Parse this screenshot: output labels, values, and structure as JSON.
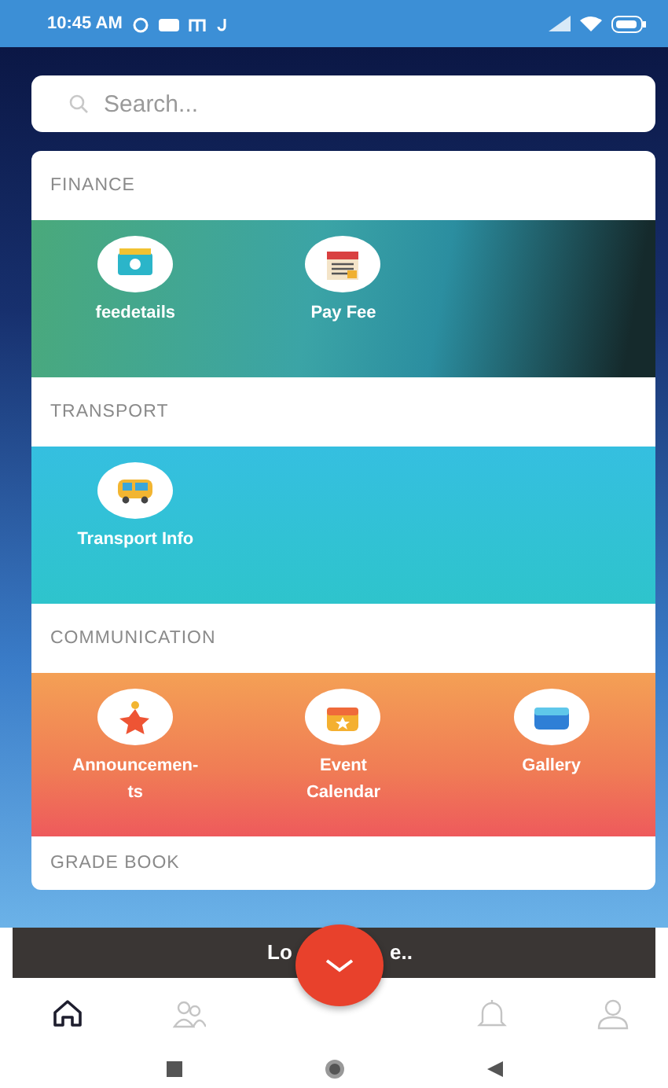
{
  "status_bar": {
    "time": "10:45 AM"
  },
  "search": {
    "placeholder": "Search..."
  },
  "sections": [
    {
      "title": "FINANCE",
      "kind": "dark-green",
      "items": [
        {
          "label": "feedetails",
          "kind": "money"
        },
        {
          "label": "Pay Fee",
          "kind": "calendar"
        }
      ]
    },
    {
      "title": "TRANSPORT",
      "kind": "cyan",
      "items": [
        {
          "label": "Transport Info",
          "kind": "bus"
        }
      ]
    },
    {
      "title": "COMMUNICATION",
      "kind": "orange",
      "items": [
        {
          "label": "Announcemen-\nts",
          "kind": "star"
        },
        {
          "label": "Event\nCalendar",
          "kind": "event"
        },
        {
          "label": "Gallery",
          "kind": "gallery"
        }
      ]
    },
    {
      "title": "GRADE BOOK",
      "kind": "plain"
    }
  ],
  "toast": {
    "left_text": "Lo",
    "right_text": "e.."
  },
  "bottom_nav": [
    {
      "kind": "home",
      "selected": true
    },
    {
      "kind": "people",
      "selected": false
    },
    {
      "kind": "bell",
      "selected": false
    },
    {
      "kind": "person",
      "selected": false
    }
  ]
}
